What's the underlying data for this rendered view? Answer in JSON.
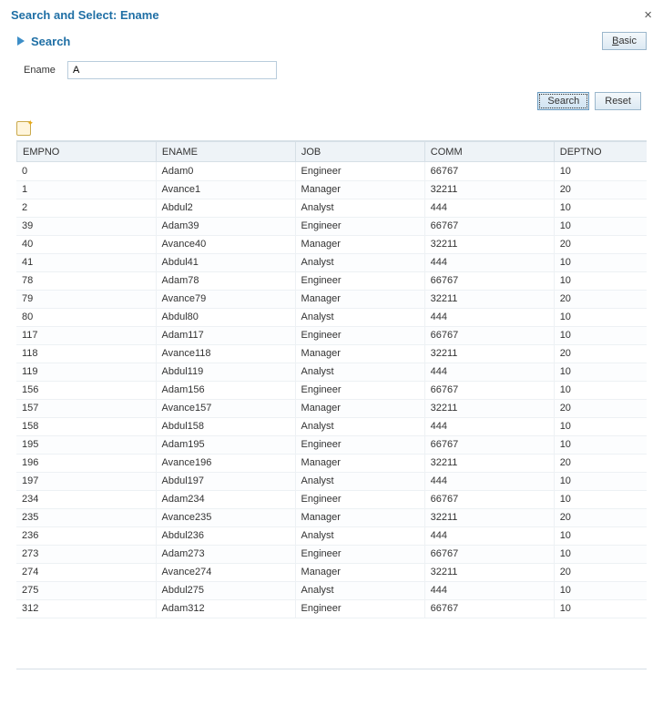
{
  "dialog": {
    "title": "Search and Select: Ename"
  },
  "search": {
    "heading": "Search",
    "basic_label_pre": "B",
    "basic_label_rest": "asic",
    "field_label": "Ename",
    "field_value": "A",
    "search_button": "Search",
    "reset_button": "Reset"
  },
  "grid": {
    "columns": [
      "EMPNO",
      "ENAME",
      "JOB",
      "COMM",
      "DEPTNO"
    ],
    "rows": [
      {
        "empno": "0",
        "ename": "Adam0",
        "job": "Engineer",
        "comm": "66767",
        "deptno": "10"
      },
      {
        "empno": "1",
        "ename": "Avance1",
        "job": "Manager",
        "comm": "32211",
        "deptno": "20"
      },
      {
        "empno": "2",
        "ename": "Abdul2",
        "job": "Analyst",
        "comm": "444",
        "deptno": "10"
      },
      {
        "empno": "39",
        "ename": "Adam39",
        "job": "Engineer",
        "comm": "66767",
        "deptno": "10"
      },
      {
        "empno": "40",
        "ename": "Avance40",
        "job": "Manager",
        "comm": "32211",
        "deptno": "20"
      },
      {
        "empno": "41",
        "ename": "Abdul41",
        "job": "Analyst",
        "comm": "444",
        "deptno": "10"
      },
      {
        "empno": "78",
        "ename": "Adam78",
        "job": "Engineer",
        "comm": "66767",
        "deptno": "10"
      },
      {
        "empno": "79",
        "ename": "Avance79",
        "job": "Manager",
        "comm": "32211",
        "deptno": "20"
      },
      {
        "empno": "80",
        "ename": "Abdul80",
        "job": "Analyst",
        "comm": "444",
        "deptno": "10"
      },
      {
        "empno": "117",
        "ename": "Adam117",
        "job": "Engineer",
        "comm": "66767",
        "deptno": "10"
      },
      {
        "empno": "118",
        "ename": "Avance118",
        "job": "Manager",
        "comm": "32211",
        "deptno": "20"
      },
      {
        "empno": "119",
        "ename": "Abdul119",
        "job": "Analyst",
        "comm": "444",
        "deptno": "10"
      },
      {
        "empno": "156",
        "ename": "Adam156",
        "job": "Engineer",
        "comm": "66767",
        "deptno": "10"
      },
      {
        "empno": "157",
        "ename": "Avance157",
        "job": "Manager",
        "comm": "32211",
        "deptno": "20"
      },
      {
        "empno": "158",
        "ename": "Abdul158",
        "job": "Analyst",
        "comm": "444",
        "deptno": "10"
      },
      {
        "empno": "195",
        "ename": "Adam195",
        "job": "Engineer",
        "comm": "66767",
        "deptno": "10"
      },
      {
        "empno": "196",
        "ename": "Avance196",
        "job": "Manager",
        "comm": "32211",
        "deptno": "20"
      },
      {
        "empno": "197",
        "ename": "Abdul197",
        "job": "Analyst",
        "comm": "444",
        "deptno": "10"
      },
      {
        "empno": "234",
        "ename": "Adam234",
        "job": "Engineer",
        "comm": "66767",
        "deptno": "10"
      },
      {
        "empno": "235",
        "ename": "Avance235",
        "job": "Manager",
        "comm": "32211",
        "deptno": "20"
      },
      {
        "empno": "236",
        "ename": "Abdul236",
        "job": "Analyst",
        "comm": "444",
        "deptno": "10"
      },
      {
        "empno": "273",
        "ename": "Adam273",
        "job": "Engineer",
        "comm": "66767",
        "deptno": "10"
      },
      {
        "empno": "274",
        "ename": "Avance274",
        "job": "Manager",
        "comm": "32211",
        "deptno": "20"
      },
      {
        "empno": "275",
        "ename": "Abdul275",
        "job": "Analyst",
        "comm": "444",
        "deptno": "10"
      },
      {
        "empno": "312",
        "ename": "Adam312",
        "job": "Engineer",
        "comm": "66767",
        "deptno": "10"
      }
    ]
  }
}
